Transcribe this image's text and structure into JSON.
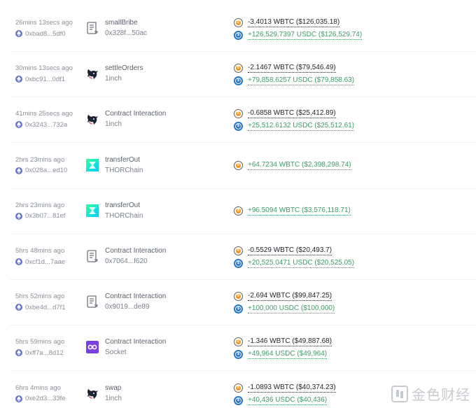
{
  "transactions": [
    {
      "time": "26mins 13secs ago",
      "address": "0xbad8...5df0",
      "icon": "scroll-icon",
      "action": "smallBribe",
      "protocol": "0x328f...50ac",
      "amounts": [
        {
          "coin": "wbtc",
          "text": "-3.4013 WBTC ($126,035.18)",
          "sign": "neg"
        },
        {
          "coin": "usdc",
          "text": "+126,529.7397 USDC ($126,529.74)",
          "sign": "pos"
        }
      ]
    },
    {
      "time": "30mins 13secs ago",
      "address": "0xbc91...0df1",
      "icon": "unicorn-icon",
      "action": "settleOrders",
      "protocol": "1inch",
      "amounts": [
        {
          "coin": "wbtc",
          "text": "-2.1467 WBTC ($79,546.49)",
          "sign": "neg"
        },
        {
          "coin": "usdc",
          "text": "+79,858.6257 USDC ($79,858.63)",
          "sign": "pos"
        }
      ]
    },
    {
      "time": "41mins 25secs ago",
      "address": "0x3243...732a",
      "icon": "unicorn-icon",
      "action": "Contract Interaction",
      "protocol": "1inch",
      "amounts": [
        {
          "coin": "wbtc",
          "text": "-0.6858 WBTC ($25,412.89)",
          "sign": "neg"
        },
        {
          "coin": "usdc",
          "text": "+25,512.6132 USDC ($25,512.61)",
          "sign": "pos"
        }
      ]
    },
    {
      "time": "2hrs 23mins ago",
      "address": "0x028a...ed10",
      "icon": "thorchain-icon",
      "action": "transferOut",
      "protocol": "THORChain",
      "amounts": [
        {
          "coin": "wbtc",
          "text": "+64.7234 WBTC ($2,398,298.74)",
          "sign": "pos"
        }
      ]
    },
    {
      "time": "2hrs 23mins ago",
      "address": "0x3b07...81ef",
      "icon": "thorchain-icon",
      "action": "transferOut",
      "protocol": "THORChain",
      "amounts": [
        {
          "coin": "wbtc",
          "text": "+96.5094 WBTC ($3,576,118.71)",
          "sign": "pos"
        }
      ]
    },
    {
      "time": "5hrs 48mins ago",
      "address": "0xcf1d...7aae",
      "icon": "scroll-icon",
      "action": "Contract Interaction",
      "protocol": "0x7064...f620",
      "amounts": [
        {
          "coin": "wbtc",
          "text": "-0.5529 WBTC ($20,493.7)",
          "sign": "neg"
        },
        {
          "coin": "usdc",
          "text": "+20,525.0471 USDC ($20,525.05)",
          "sign": "pos"
        }
      ]
    },
    {
      "time": "5hrs 52mins ago",
      "address": "0xbe4d...d7f1",
      "icon": "scroll-icon",
      "action": "Contract Interaction",
      "protocol": "0x9019...de89",
      "amounts": [
        {
          "coin": "wbtc",
          "text": "-2.694 WBTC ($99,847.25)",
          "sign": "neg"
        },
        {
          "coin": "usdc",
          "text": "+100,000 USDC ($100,000)",
          "sign": "pos"
        }
      ]
    },
    {
      "time": "5hrs 59mins ago",
      "address": "0xff7a...8d12",
      "icon": "socket-icon",
      "action": "Contract Interaction",
      "protocol": "Socket",
      "amounts": [
        {
          "coin": "wbtc",
          "text": "-1.346 WBTC ($49,887.68)",
          "sign": "neg"
        },
        {
          "coin": "usdc",
          "text": "+49,964 USDC ($49,964)",
          "sign": "pos"
        }
      ]
    },
    {
      "time": "6hrs 4mins ago",
      "address": "0xe2d3...33fe",
      "icon": "unicorn-icon",
      "action": "swap",
      "protocol": "1inch",
      "amounts": [
        {
          "coin": "wbtc",
          "text": "-1.0893 WBTC ($40,374.23)",
          "sign": "neg"
        },
        {
          "coin": "usdc",
          "text": "+40,436 USDC ($40,436)",
          "sign": "pos"
        }
      ]
    }
  ],
  "watermark": {
    "text": "金色财经"
  },
  "colors": {
    "eth": "#6272c9",
    "wbtc": "#f7931a",
    "usdc": "#2775ca",
    "positive": "#3e9c6b",
    "negative": "#1f2329"
  }
}
